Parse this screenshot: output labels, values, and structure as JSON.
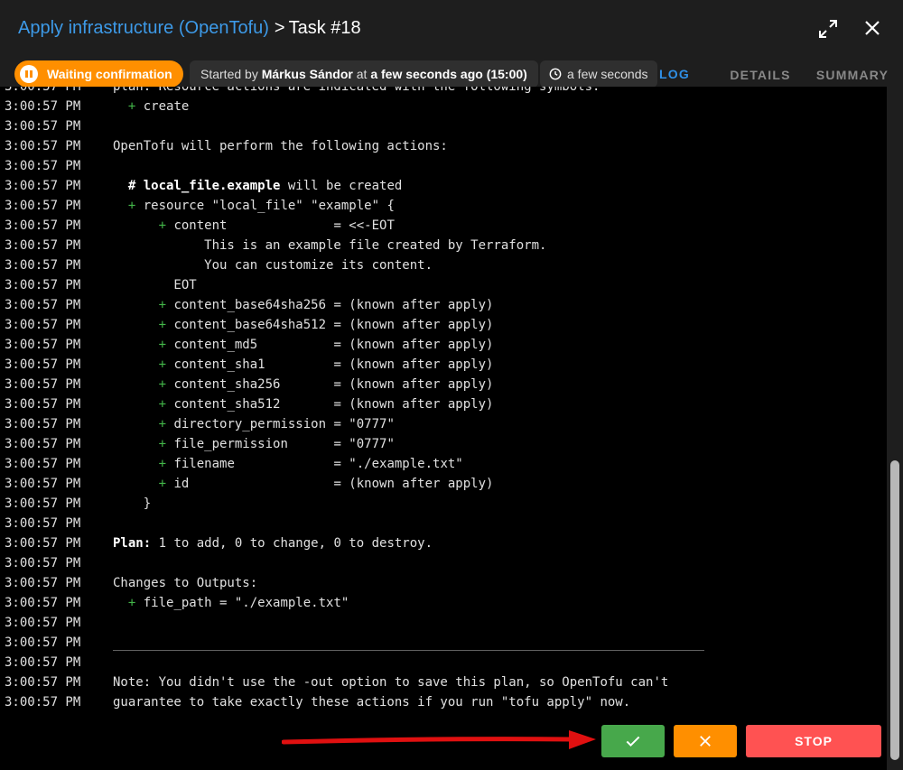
{
  "header": {
    "template_name": "Apply infrastructure (OpenTofu)",
    "separator": ">",
    "task_label": "Task #18"
  },
  "status": {
    "label": "Waiting confirmation",
    "color": "#ff8f00"
  },
  "meta": {
    "started_prefix": "Started by",
    "user": "Márkus Sándor",
    "at_text": "at",
    "time": "a few seconds ago (15:00)",
    "duration": "a few seconds"
  },
  "tabs": [
    {
      "label": "LOG",
      "active": true
    },
    {
      "label": "DETAILS",
      "active": false
    },
    {
      "label": "SUMMARY",
      "active": false
    }
  ],
  "log": {
    "timestamp": "3:00:57 PM",
    "lines": [
      {
        "segments": [
          {
            "t": "plan. Resource actions are indicated with the following symbols:"
          }
        ]
      },
      {
        "segments": [
          {
            "t": "  "
          },
          {
            "t": "+",
            "c": "plus"
          },
          {
            "t": " create"
          }
        ]
      },
      {
        "segments": [
          {
            "t": ""
          }
        ]
      },
      {
        "segments": [
          {
            "t": "OpenTofu will perform the following actions:"
          }
        ]
      },
      {
        "segments": [
          {
            "t": ""
          }
        ]
      },
      {
        "segments": [
          {
            "t": "  "
          },
          {
            "t": "# local_file.example",
            "c": "bold"
          },
          {
            "t": " will be created"
          }
        ]
      },
      {
        "segments": [
          {
            "t": "  "
          },
          {
            "t": "+",
            "c": "plus"
          },
          {
            "t": " resource \"local_file\" \"example\" {"
          }
        ]
      },
      {
        "segments": [
          {
            "t": "      "
          },
          {
            "t": "+",
            "c": "plus"
          },
          {
            "t": " content              = <<-EOT"
          }
        ]
      },
      {
        "segments": [
          {
            "t": "            This is an example file created by Terraform."
          }
        ]
      },
      {
        "segments": [
          {
            "t": "            You can customize its content."
          }
        ]
      },
      {
        "segments": [
          {
            "t": "        EOT"
          }
        ]
      },
      {
        "segments": [
          {
            "t": "      "
          },
          {
            "t": "+",
            "c": "plus"
          },
          {
            "t": " content_base64sha256 = (known after apply)"
          }
        ]
      },
      {
        "segments": [
          {
            "t": "      "
          },
          {
            "t": "+",
            "c": "plus"
          },
          {
            "t": " content_base64sha512 = (known after apply)"
          }
        ]
      },
      {
        "segments": [
          {
            "t": "      "
          },
          {
            "t": "+",
            "c": "plus"
          },
          {
            "t": " content_md5          = (known after apply)"
          }
        ]
      },
      {
        "segments": [
          {
            "t": "      "
          },
          {
            "t": "+",
            "c": "plus"
          },
          {
            "t": " content_sha1         = (known after apply)"
          }
        ]
      },
      {
        "segments": [
          {
            "t": "      "
          },
          {
            "t": "+",
            "c": "plus"
          },
          {
            "t": " content_sha256       = (known after apply)"
          }
        ]
      },
      {
        "segments": [
          {
            "t": "      "
          },
          {
            "t": "+",
            "c": "plus"
          },
          {
            "t": " content_sha512       = (known after apply)"
          }
        ]
      },
      {
        "segments": [
          {
            "t": "      "
          },
          {
            "t": "+",
            "c": "plus"
          },
          {
            "t": " directory_permission = \"0777\""
          }
        ]
      },
      {
        "segments": [
          {
            "t": "      "
          },
          {
            "t": "+",
            "c": "plus"
          },
          {
            "t": " file_permission      = \"0777\""
          }
        ]
      },
      {
        "segments": [
          {
            "t": "      "
          },
          {
            "t": "+",
            "c": "plus"
          },
          {
            "t": " filename             = \"./example.txt\""
          }
        ]
      },
      {
        "segments": [
          {
            "t": "      "
          },
          {
            "t": "+",
            "c": "plus"
          },
          {
            "t": " id                   = (known after apply)"
          }
        ]
      },
      {
        "segments": [
          {
            "t": "    }"
          }
        ]
      },
      {
        "segments": [
          {
            "t": ""
          }
        ]
      },
      {
        "segments": [
          {
            "t": "Plan:",
            "c": "bold"
          },
          {
            "t": " 1 to add, 0 to change, 0 to destroy."
          }
        ]
      },
      {
        "segments": [
          {
            "t": ""
          }
        ]
      },
      {
        "segments": [
          {
            "t": "Changes to Outputs:"
          }
        ]
      },
      {
        "segments": [
          {
            "t": "  "
          },
          {
            "t": "+",
            "c": "plus"
          },
          {
            "t": " file_path = \"./example.txt\""
          }
        ]
      },
      {
        "segments": [
          {
            "t": ""
          }
        ]
      },
      {
        "segments": [
          {
            "t": ""
          }
        ]
      },
      {
        "segments": [
          {
            "t": ""
          }
        ]
      },
      {
        "segments": [
          {
            "t": "Note: You didn't use the -out option to save this plan, so OpenTofu can't"
          }
        ]
      },
      {
        "segments": [
          {
            "t": "guarantee to take exactly these actions if you run \"tofu apply\" now."
          }
        ]
      }
    ]
  },
  "actions": {
    "confirm_icon": "check-icon",
    "reject_icon": "close-icon",
    "stop_label": "STOP",
    "confirm_color": "#47a84b",
    "reject_color": "#ff8f00",
    "stop_color": "#ff5252",
    "annotation_arrow_color": "#e01010"
  }
}
